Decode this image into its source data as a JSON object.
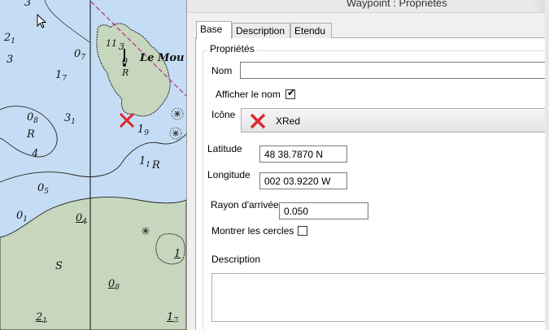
{
  "chart": {
    "island_name": "Le Mou",
    "island_number": "11",
    "island_depth_1": "3",
    "island_depth_2": "0",
    "island_rock": "R",
    "depths": [
      {
        "main": "3",
        "sub": ""
      },
      {
        "main": "2",
        "sub": "1"
      },
      {
        "main": "3",
        "sub": ""
      },
      {
        "main": "0",
        "sub": "7"
      },
      {
        "main": "1",
        "sub": "7"
      },
      {
        "main": "0",
        "sub": "8"
      },
      {
        "main": "3",
        "sub": "1"
      },
      {
        "main": "R",
        "sub": ""
      },
      {
        "main": "4",
        "sub": ""
      },
      {
        "main": "1",
        "sub": "9"
      },
      {
        "main": "1",
        "sub": "1"
      },
      {
        "main": "R",
        "sub": ""
      },
      {
        "main": "0",
        "sub": "5"
      },
      {
        "main": "0",
        "sub": "1"
      },
      {
        "main": "0",
        "sub": "4"
      },
      {
        "main": "S",
        "sub": ""
      },
      {
        "main": "0",
        "sub": "8"
      },
      {
        "main": "2",
        "sub": "1"
      },
      {
        "main": "1",
        "sub": "7"
      },
      {
        "main": "1",
        "sub": ""
      }
    ]
  },
  "dialog": {
    "title": "Waypoint : Propriétés",
    "tabs": [
      {
        "label": "Base",
        "active": true
      },
      {
        "label": "Description",
        "active": false
      },
      {
        "label": "Etendu",
        "active": false
      }
    ],
    "group_label": "Propriétés",
    "name_label": "Nom",
    "name_value": "",
    "show_name_label": "Afficher le nom",
    "show_name_checked": true,
    "show_name_check": "✔",
    "icon_label": "Icône",
    "icon_value": "XRed",
    "icon_name": "red-x-waypoint-icon",
    "latitude_label": "Latitude",
    "latitude_value": "48 38.7870 N",
    "longitude_label": "Longitude",
    "longitude_value": "002 03.9220 W",
    "arrival_radius_label": "Rayon d'arrivée",
    "arrival_radius_value": "0.050",
    "show_circles_label": "Montrer les cercles",
    "show_circles_checked": false,
    "description_label": "Description",
    "description_value": ""
  },
  "colors": {
    "shallow_water": "#c5ddf4",
    "land": "#c6d7bd",
    "waypoint_red": "#e0262c",
    "track_magenta": "#b0308c"
  }
}
